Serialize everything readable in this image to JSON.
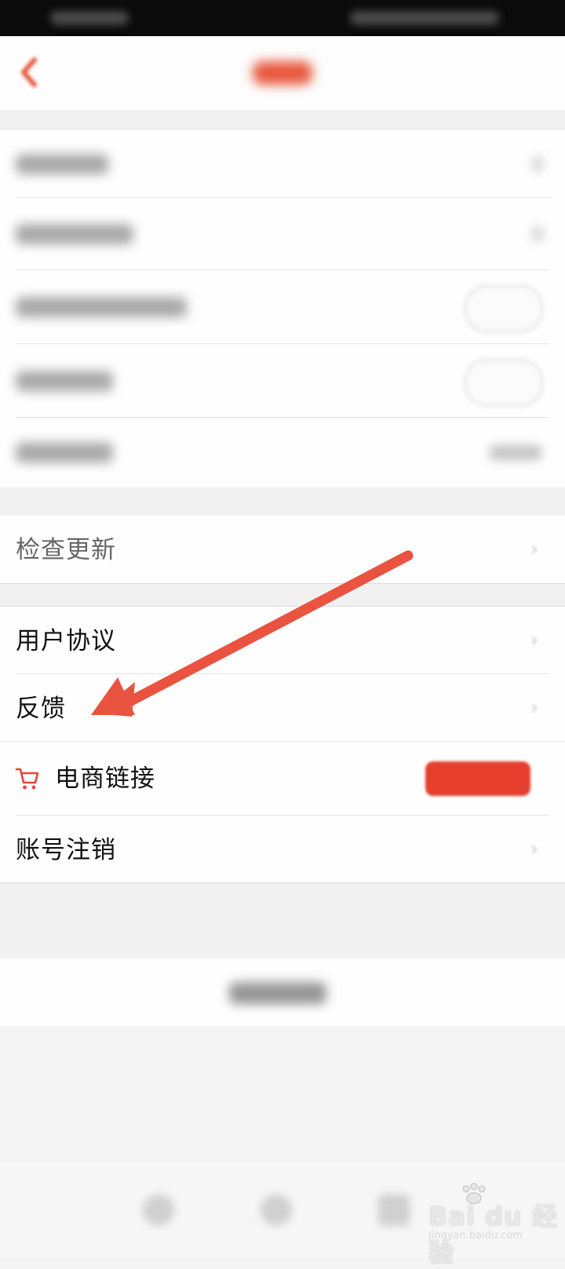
{
  "menu": {
    "check_update": "检查更新",
    "user_agreement": "用户协议",
    "feedback": "反馈",
    "ecommerce_link": "电商链接",
    "account_cancel": "账号注销"
  },
  "icons": {
    "back": "chevron-left",
    "cart": "shopping-cart",
    "row_chevron": "chevron-right"
  },
  "colors": {
    "accent": "#e8593f",
    "arrow": "#e9533f",
    "pill": "#e63f2e"
  },
  "watermark": {
    "brand": "Bai du 经验",
    "url": "jingyan.baidu.com"
  }
}
